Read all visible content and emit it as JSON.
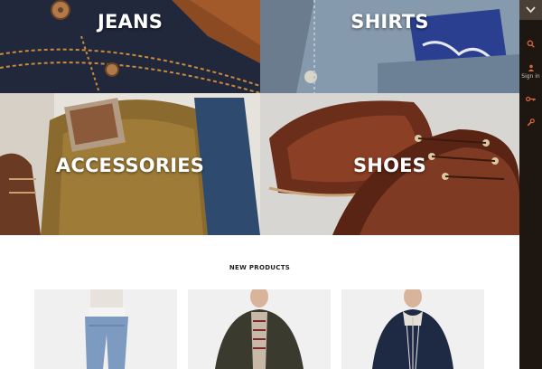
{
  "categories": {
    "jeans": "JEANS",
    "shirts": "SHIRTS",
    "accessories": "ACCESSORIES",
    "shoes": "SHOES"
  },
  "sidebar": {
    "icons": [
      "chevron-down-icon",
      "search-icon",
      "user-icon",
      "key-icon",
      "wrench-icon"
    ],
    "signin_label": "Sign in"
  },
  "products_section": {
    "title": "NEW PRODUCTS",
    "items": [
      {
        "image": "jeans-model-image"
      },
      {
        "image": "jacket-model-image"
      },
      {
        "image": "navy-jacket-model-image"
      }
    ]
  }
}
